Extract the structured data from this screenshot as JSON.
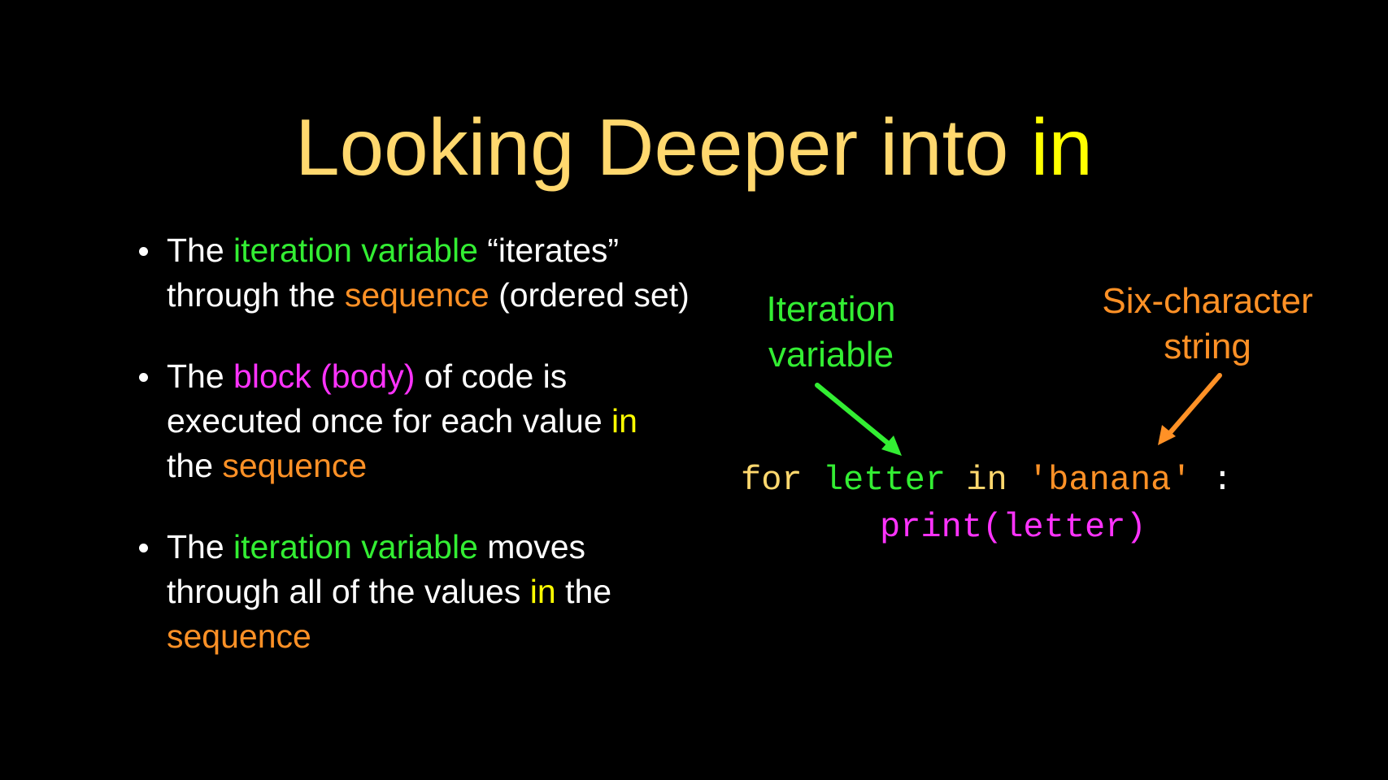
{
  "colors": {
    "background": "#000000",
    "title": "#ffd86e",
    "keyword_highlight": "#ffff00",
    "body_text": "#ffffff",
    "iteration_variable": "#33ee33",
    "sequence": "#ff9126",
    "block": "#ff33ff"
  },
  "title": {
    "text": "Looking Deeper into ",
    "keyword": "in"
  },
  "bullets": [
    {
      "segments": [
        {
          "text": "The ",
          "color": "white"
        },
        {
          "text": "iteration variable",
          "color": "green"
        },
        {
          "text": " “iterates” through the ",
          "color": "white"
        },
        {
          "text": "sequence",
          "color": "orange"
        },
        {
          "text": " (ordered set)",
          "color": "white"
        }
      ]
    },
    {
      "segments": [
        {
          "text": "The ",
          "color": "white"
        },
        {
          "text": "block (body)",
          "color": "magenta"
        },
        {
          "text": " of code is executed once for each value ",
          "color": "white"
        },
        {
          "text": "in",
          "color": "yellow"
        },
        {
          "text": " the ",
          "color": "white"
        },
        {
          "text": "sequence",
          "color": "orange"
        }
      ]
    },
    {
      "segments": [
        {
          "text": "The ",
          "color": "white"
        },
        {
          "text": "iteration variable",
          "color": "green"
        },
        {
          "text": " moves through all of the values ",
          "color": "white"
        },
        {
          "text": "in",
          "color": "yellow"
        },
        {
          "text": " the ",
          "color": "white"
        },
        {
          "text": "sequence",
          "color": "orange"
        }
      ]
    }
  ],
  "callouts": {
    "iteration_variable": {
      "line1": "Iteration",
      "line2": "variable"
    },
    "six_char_string": {
      "line1": "Six-character",
      "line2": "string"
    }
  },
  "code": {
    "kw_for": "for",
    "var": "letter",
    "kw_in": "in",
    "string": "'banana'",
    "colon": ":",
    "body": "print(letter)"
  }
}
